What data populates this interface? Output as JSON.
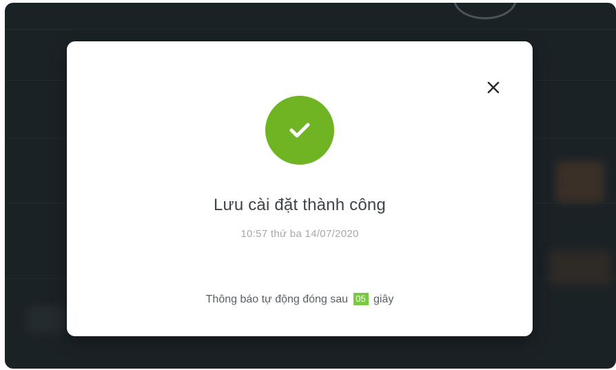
{
  "modal": {
    "close_icon": "close-icon",
    "success_icon": "checkmark-icon",
    "title": "Lưu cài đặt thành công",
    "timestamp": "10:57 thứ ba 14/07/2020",
    "auto_close_before": "Thông báo tự động đóng sau",
    "countdown": "05",
    "auto_close_after": "giây"
  },
  "colors": {
    "success": "#6fb523",
    "countdown_highlight": "#7ac943",
    "backdrop": "#1b2226"
  }
}
